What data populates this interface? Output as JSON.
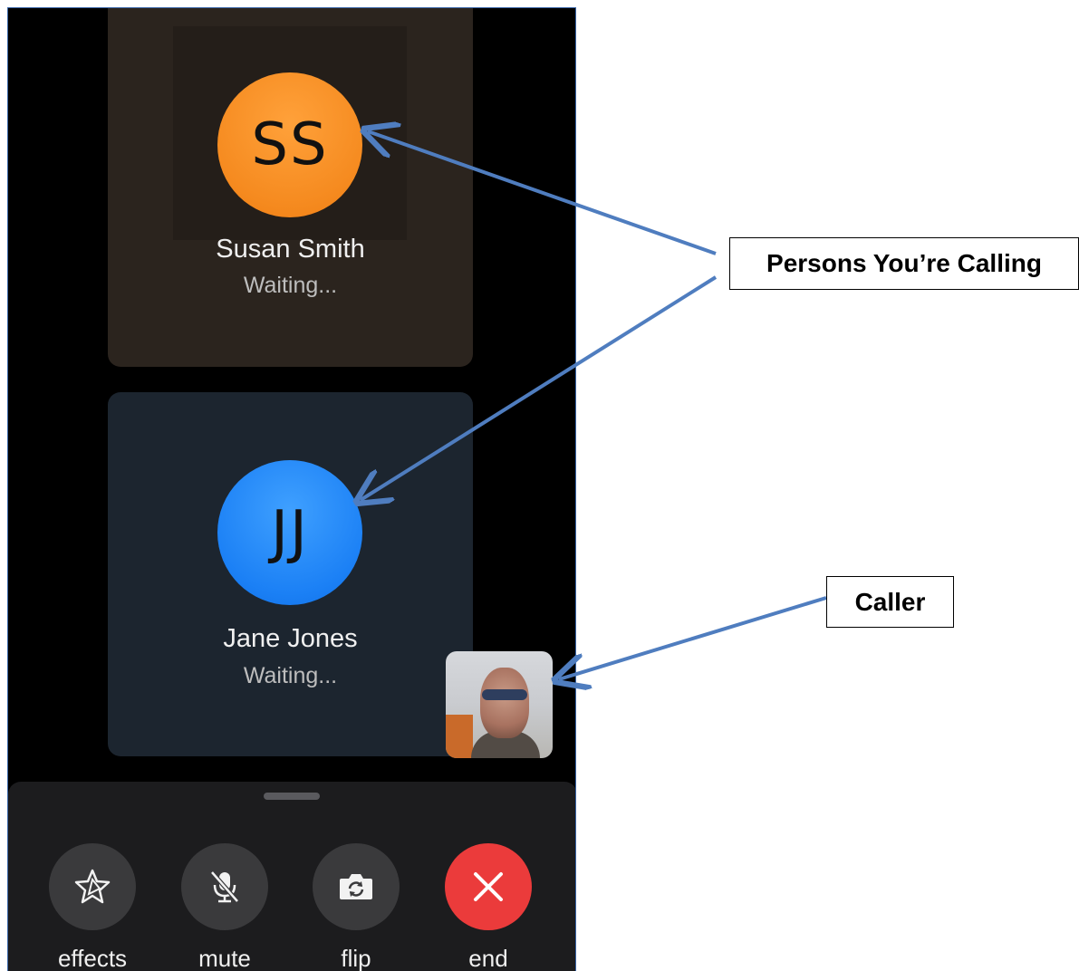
{
  "participants": [
    {
      "initials": "SS",
      "name": "Susan Smith",
      "status": "Waiting...",
      "color": "#f58a1f"
    },
    {
      "initials": "JJ",
      "name": "Jane Jones",
      "status": "Waiting...",
      "color": "#1b80f5"
    }
  ],
  "controls": [
    {
      "label": "effects",
      "icon": "star-effects-icon"
    },
    {
      "label": "mute",
      "icon": "microphone-muted-icon"
    },
    {
      "label": "flip",
      "icon": "camera-flip-icon"
    },
    {
      "label": "end",
      "icon": "close-x-icon",
      "color": "#eb3b3b"
    }
  ],
  "annotations": {
    "persons_label": "Persons You’re Calling",
    "caller_label": "Caller"
  },
  "colors": {
    "arrow": "#4f7dbf",
    "end_button": "#eb3b3b"
  }
}
